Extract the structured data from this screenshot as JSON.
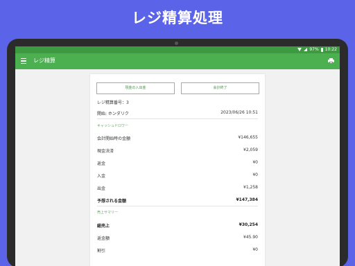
{
  "headline": "レジ精算処理",
  "status": {
    "battery": "97%",
    "time": "10:22"
  },
  "appbar": {
    "title": "レジ精算"
  },
  "buttons": {
    "cash_in_out": "現金の入出金",
    "finish": "会計終了"
  },
  "info": {
    "number_label": "レジ精算番号：3",
    "start_label": "開始: ホンダリク",
    "start_value": "2023/06/26 10:51"
  },
  "cash_flow": {
    "title": "キャッシュドロワー",
    "rows": [
      {
        "label": "会計開始時の金額",
        "value": "¥146,655"
      },
      {
        "label": "現金決済",
        "value": "¥2,059"
      },
      {
        "label": "返金",
        "value": "¥0"
      },
      {
        "label": "入金",
        "value": "¥0"
      },
      {
        "label": "出金",
        "value": "¥1,258"
      }
    ],
    "expected_label": "予想される金額",
    "expected_value": "¥147,384"
  },
  "sales": {
    "title": "売上サマリー",
    "rows": [
      {
        "label": "総売上",
        "value": "¥30,254"
      },
      {
        "label": "返金額",
        "value": "¥45.90"
      },
      {
        "label": "割引",
        "value": "¥0"
      }
    ]
  }
}
